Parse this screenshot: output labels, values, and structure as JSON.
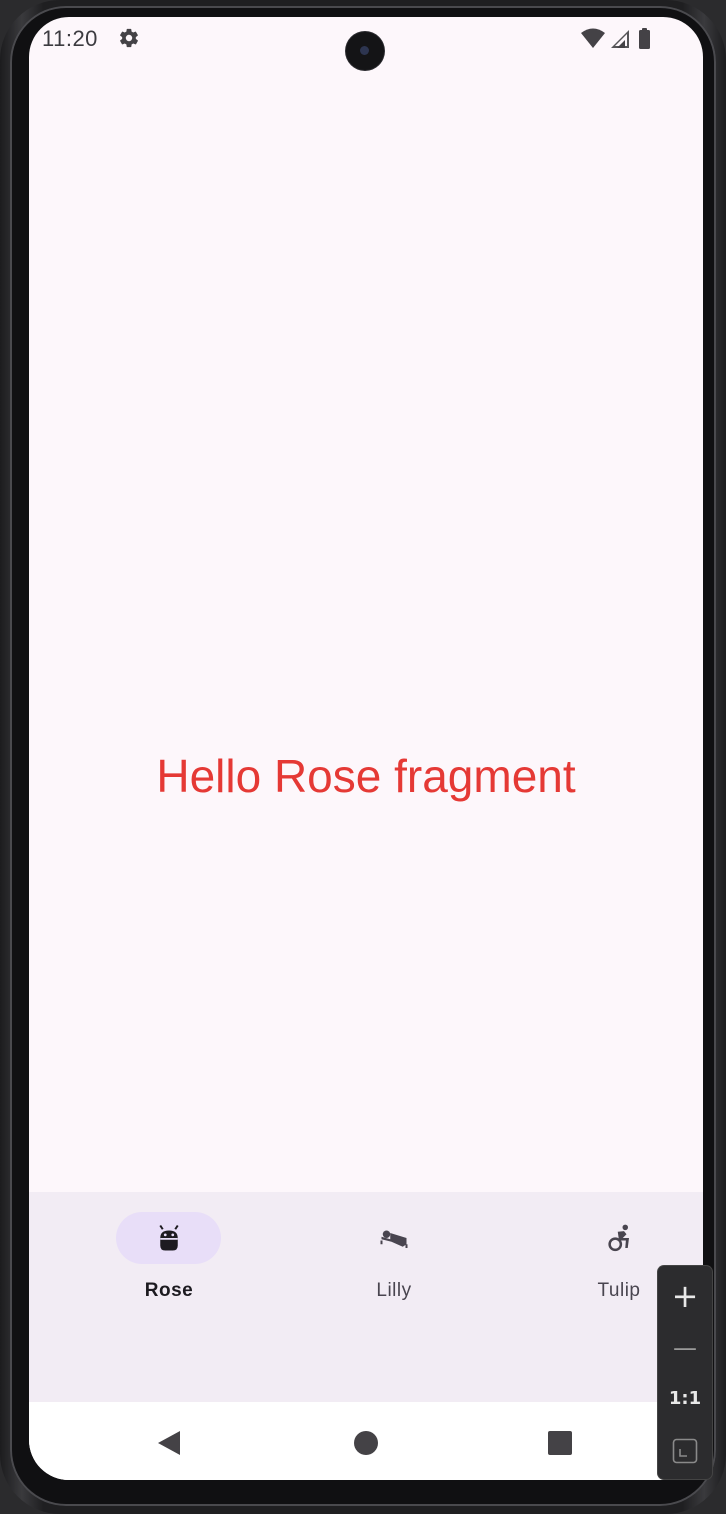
{
  "status_bar": {
    "time": "11:20",
    "icons": [
      "settings-icon",
      "wifi-icon",
      "signal-icon",
      "battery-icon"
    ]
  },
  "main": {
    "message": "Hello Rose fragment",
    "message_color": "#e53935"
  },
  "bottom_nav": {
    "items": [
      {
        "label": "Rose",
        "icon": "android-icon",
        "active": true
      },
      {
        "label": "Lilly",
        "icon": "hotel-bed-icon",
        "active": false
      },
      {
        "label": "Tulip",
        "icon": "accessible-forward-icon",
        "active": false
      }
    ],
    "active_indicator_color": "#e8def8",
    "background_color": "#f2ecf4"
  },
  "system_nav": {
    "buttons": [
      "back-icon",
      "home-icon",
      "recents-icon"
    ]
  },
  "zoom_controls": {
    "plus_label": "+",
    "minus_label": "—",
    "actual_size_label": "1:1"
  }
}
